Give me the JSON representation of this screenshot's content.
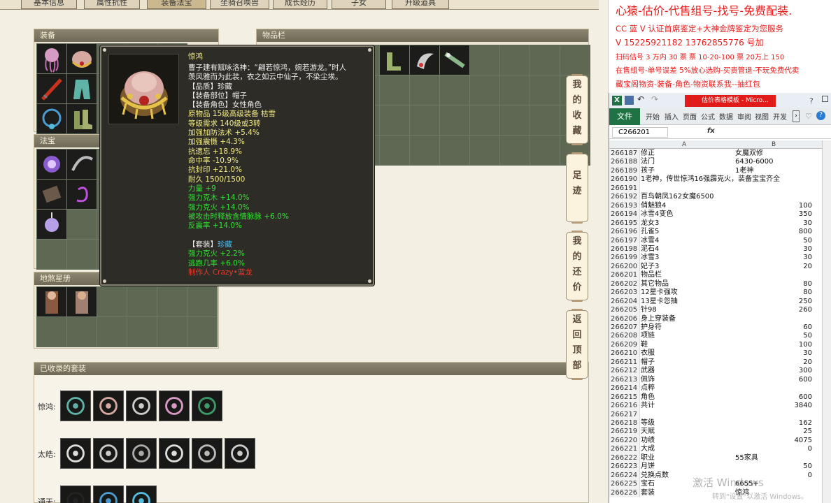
{
  "tabs": [
    "基本信息",
    "属性抗性",
    "装备法宝",
    "坐骑召唤兽",
    "成长经历",
    "子女",
    "升级道具"
  ],
  "panels": {
    "equipment_title": "装备",
    "inventory_title": "物品栏",
    "fabao_title": "法宝",
    "stars_title": "地煞星册",
    "sets_title": "已收录的套装"
  },
  "tooltip": {
    "name": "惊鸿",
    "desc1": "曹子建有赋咏洛神：“翩若惊鸿，婉若游龙。”时人",
    "desc2": "羡风雅而为此装，衣之如云中仙子，不染尘埃。",
    "quality": "【品质】珍藏",
    "slot": "【装备部位】帽子",
    "role": "【装备角色】女性角色",
    "origin": "原物品 15级高级装备 枯雪",
    "level_req": "等级需求 140级或3转",
    "stat1": "加强加防法术 +5.4%",
    "stat2": "加强震慑 +4.3%",
    "stat3": "抗遗忘 +18.9%",
    "stat4": "命中率 -10.9%",
    "stat5": "抗封印 +21.0%",
    "durability": "耐久 1500/1500",
    "g1": "力量 +9",
    "g2": "强力克木 +14.0%",
    "g3": "强力克火 +14.0%",
    "g4": "被攻击时释放含情脉脉 +6.0%",
    "g5": "反震率 +14.0%",
    "set_label": "【套装】",
    "set_name": "珍藏",
    "set_g1": "强力克火 +2.2%",
    "set_g2": "逃跑几率 +6.0%",
    "maker": "制作人 Crazy•蓝龙"
  },
  "side_buttons": [
    "我的收藏",
    "足迹",
    "我的还价",
    "返回顶部"
  ],
  "sets": [
    {
      "label": "惊鸿:"
    },
    {
      "label": "太皓:"
    },
    {
      "label": "通天:"
    }
  ],
  "ad": {
    "line1": "心猿-估价-代售组号-找号-免费配装.",
    "line2": "CC 蓝 V 认证首席鉴定+大神金牌鉴定为您服务",
    "line3": "V 15225921182  13762855776  号加",
    "line4": "扫码估号 3 万内 30 票  票 10-20-100 票 20万上 150",
    "line5": "在售组号-单号误差 5%放心选购-买贵管退-不玩免费代卖",
    "line6": "藏宝阁物资-装备-角色-物资联系我--抽红包"
  },
  "excel": {
    "title": "估价表格模板 - Micro...",
    "ribbon": [
      "文件",
      "开始",
      "插入",
      "页面",
      "公式",
      "数据",
      "审阅",
      "视图",
      "开发"
    ],
    "name_box": "C266201",
    "fx": "fx",
    "col_a": "A",
    "col_b": "B",
    "rows": [
      {
        "n": "266187",
        "a": "修正",
        "b": "女魔双修",
        "num": false
      },
      {
        "n": "266188",
        "a": "法门",
        "b": "6430-6000",
        "num": false
      },
      {
        "n": "266189",
        "a": "孩子",
        "b": "1老神",
        "num": false
      },
      {
        "n": "266190",
        "a": "1老神，传世惊鸿16强霹克火，装备宝宝齐全",
        "b": "",
        "num": false
      },
      {
        "n": "266191",
        "a": "",
        "b": "",
        "num": false
      },
      {
        "n": "266192",
        "a": "百鸟朝凤162女魔6500",
        "b": "",
        "num": false
      },
      {
        "n": "266193",
        "a": "俏魅狼4",
        "b": "100",
        "num": true
      },
      {
        "n": "266194",
        "a": "冰雪4变色",
        "b": "350",
        "num": true
      },
      {
        "n": "266195",
        "a": "龙女3",
        "b": "30",
        "num": true
      },
      {
        "n": "266196",
        "a": "孔雀5",
        "b": "800",
        "num": true
      },
      {
        "n": "266197",
        "a": "冰雪4",
        "b": "50",
        "num": true
      },
      {
        "n": "266198",
        "a": "泥石4",
        "b": "30",
        "num": true
      },
      {
        "n": "266199",
        "a": "冰雪3",
        "b": "30",
        "num": true
      },
      {
        "n": "266200",
        "a": "妃子3",
        "b": "20",
        "num": true
      },
      {
        "n": "266201",
        "a": "物品栏",
        "b": "",
        "num": false
      },
      {
        "n": "266202",
        "a": "其它物品",
        "b": "80",
        "num": true
      },
      {
        "n": "266203",
        "a": "12星卡强攻",
        "b": "80",
        "num": true
      },
      {
        "n": "266204",
        "a": "13星卡忽抽",
        "b": "250",
        "num": true
      },
      {
        "n": "266205",
        "a": "针98",
        "b": "260",
        "num": true
      },
      {
        "n": "266206",
        "a": "身上穿装备",
        "b": "",
        "num": false
      },
      {
        "n": "266207",
        "a": "护身符",
        "b": "60",
        "num": true
      },
      {
        "n": "266208",
        "a": "项链",
        "b": "50",
        "num": true
      },
      {
        "n": "266209",
        "a": "鞋",
        "b": "100",
        "num": true
      },
      {
        "n": "266210",
        "a": "衣服",
        "b": "30",
        "num": true
      },
      {
        "n": "266211",
        "a": "帽子",
        "b": "20",
        "num": true
      },
      {
        "n": "266212",
        "a": "武器",
        "b": "300",
        "num": true
      },
      {
        "n": "266213",
        "a": "佩饰",
        "b": "600",
        "num": true
      },
      {
        "n": "266214",
        "a": "点粹",
        "b": "",
        "num": false
      },
      {
        "n": "266215",
        "a": "角色",
        "b": "600",
        "num": true
      },
      {
        "n": "266216",
        "a": "共计",
        "b": "3840",
        "num": true
      },
      {
        "n": "266217",
        "a": "",
        "b": "",
        "num": false
      },
      {
        "n": "266218",
        "a": "等级",
        "b": "162",
        "num": true
      },
      {
        "n": "266219",
        "a": "天赋",
        "b": "25",
        "num": true
      },
      {
        "n": "266220",
        "a": "功绩",
        "b": "4075",
        "num": true
      },
      {
        "n": "266221",
        "a": "大成",
        "b": "0",
        "num": true
      },
      {
        "n": "266222",
        "a": "职业",
        "b": "55家具",
        "num": false
      },
      {
        "n": "266223",
        "a": "月饼",
        "b": "50",
        "num": true
      },
      {
        "n": "266224",
        "a": "兑换点数",
        "b": "0",
        "num": true
      },
      {
        "n": "266225",
        "a": "宝石",
        "b": "6655+",
        "num": false
      },
      {
        "n": "266226",
        "a": "套装",
        "b": "惊鸿",
        "num": false
      }
    ]
  },
  "watermark": {
    "line1": "激活 Windows",
    "line2": "转到\"设置\"以激活 Windows。"
  }
}
